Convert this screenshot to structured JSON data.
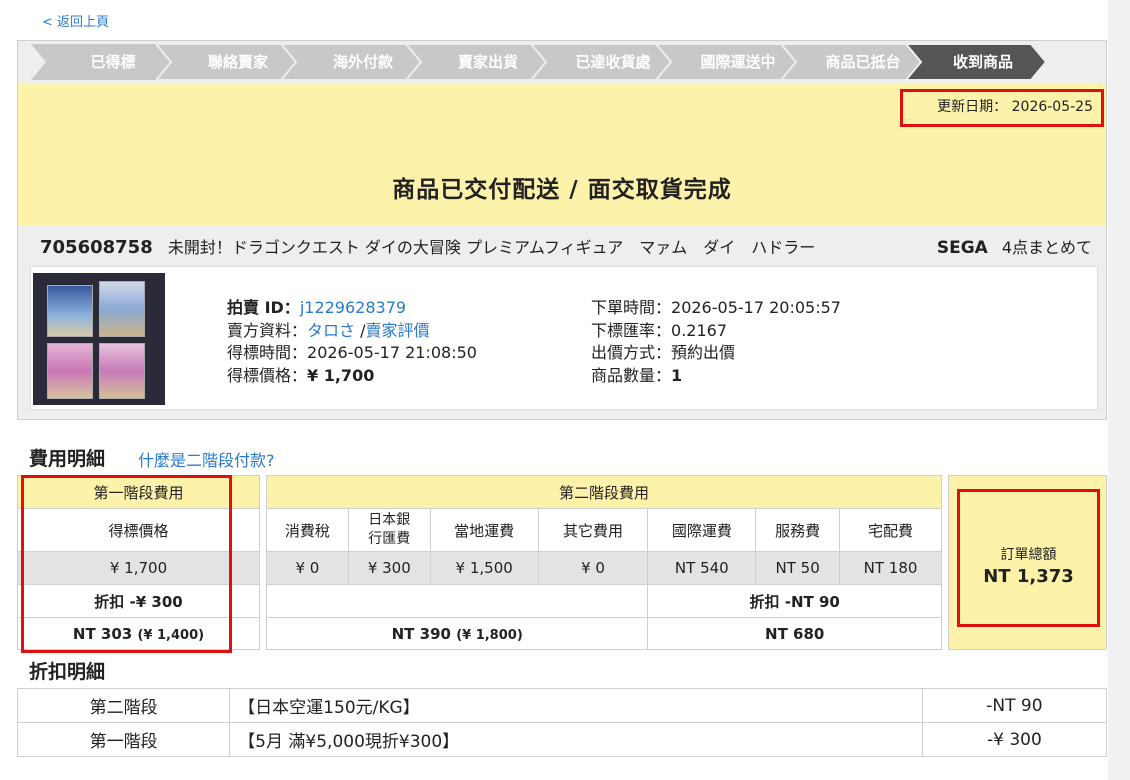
{
  "nav": {
    "back_label": "< 返回上頁"
  },
  "steps": [
    "已得標",
    "聯絡賣家",
    "海外付款",
    "賣家出貨",
    "已達收貨處",
    "國際運送中",
    "商品已抵台",
    "收到商品"
  ],
  "status": {
    "update_label": "更新日期：",
    "update_date": "2026-05-25",
    "title": "商品已交付配送 / 面交取貨完成"
  },
  "item": {
    "id": "705608758",
    "name": "未開封！ドラゴンクエスト ダイの大冒険 プレミアムフィギュア　マァム　ダイ　ハドラー",
    "brand": "SEGA",
    "bundle": "4点まとめて"
  },
  "details": {
    "auction_id_label": "拍賣 ID：",
    "auction_id": "j1229628379",
    "seller_label": "賣方資料：",
    "seller_name": "タロさ",
    "seller_sep": "/",
    "seller_rating": "賣家評價",
    "won_time_label": "得標時間：",
    "won_time": "2026-05-17 21:08:50",
    "won_price_label": "得標價格：",
    "won_price": "¥ 1,700",
    "order_time_label": "下單時間：",
    "order_time": "2026-05-17 20:05:57",
    "rate_label": "下標匯率：",
    "rate": "0.2167",
    "bid_method_label": "出價方式：",
    "bid_method": "預約出價",
    "qty_label": "商品數量：",
    "qty": "1"
  },
  "fees": {
    "title": "費用明細",
    "what_link": "什麼是二階段付款?",
    "stage1": {
      "header": "第一階段費用",
      "col": "得標價格",
      "value": "¥ 1,700",
      "discount": "折扣 -¥ 300",
      "total_main": "NT 303",
      "total_sub": "(¥ 1,400)"
    },
    "stage2": {
      "header": "第二階段費用",
      "columns": [
        "消費稅",
        "日本銀行匯費",
        "當地運費",
        "其它費用",
        "國際運費",
        "服務費",
        "宅配費"
      ],
      "values": [
        "¥ 0",
        "¥ 300",
        "¥ 1,500",
        "¥ 0",
        "NT 540",
        "NT 50",
        "NT 180"
      ],
      "discount": "折扣 -NT 90",
      "sub_main": "NT 390",
      "sub_sub": "(¥ 1,800)",
      "sub_right": "NT 680"
    },
    "total": {
      "label": "訂單總額",
      "value": "NT 1,373"
    }
  },
  "discounts": {
    "title": "折扣明細",
    "rows": [
      {
        "stage": "第二階段",
        "desc": "【日本空運150元/KG】",
        "amount": "-NT 90"
      },
      {
        "stage": "第一階段",
        "desc": "【5月 滿¥5,000現折¥300】",
        "amount": "-¥ 300"
      }
    ]
  },
  "colors": {
    "accent": "#2a7ad1",
    "highlight": "#fdf2a9",
    "alert": "#e01010",
    "step_gray": "#c8c8c8",
    "step_active": "#555555"
  }
}
